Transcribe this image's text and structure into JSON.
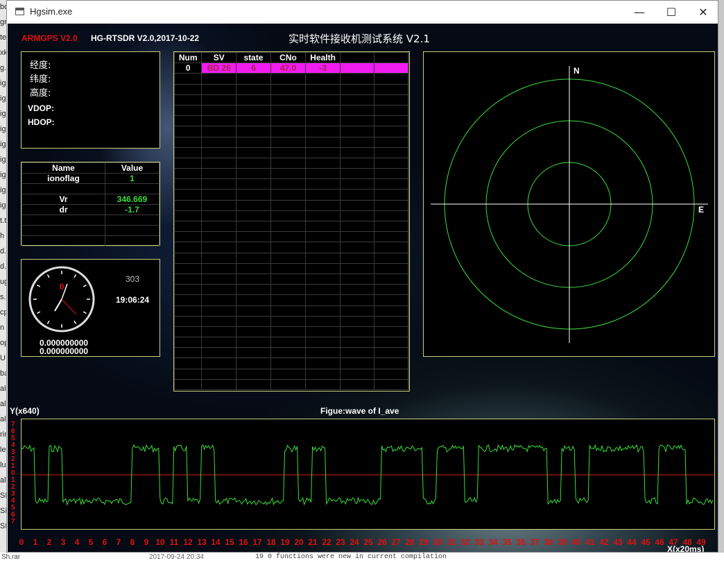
{
  "window": {
    "title": "Hgsim.exe",
    "minimize_glyph": "—",
    "maximize_glyph": "☐",
    "close_glyph": "✕"
  },
  "header": {
    "brand": "ARMGPS V2.0",
    "version": "HG-RTSDR V2.0,2017-10-22",
    "system_title": "实时软件接收机测试系统 V2.1"
  },
  "position": {
    "lon_label": "经度:",
    "lat_label": "纬度:",
    "alt_label": "高度:",
    "vdop_label": "VDOP:",
    "hdop_label": "HDOP:"
  },
  "name_value": {
    "headers": [
      "Name",
      "Value"
    ],
    "rows": [
      {
        "name": "ionoflag",
        "value": "1"
      },
      {
        "name": "",
        "value": ""
      },
      {
        "name": "Vr",
        "value": "346.669"
      },
      {
        "name": "dr",
        "value": "-1.7"
      },
      {
        "name": "",
        "value": ""
      },
      {
        "name": "",
        "value": ""
      },
      {
        "name": "",
        "value": ""
      }
    ]
  },
  "clock": {
    "dial_mark": "0",
    "counter": "303",
    "time": "19:06:24",
    "value_1": "0.000000000",
    "value_2": "0.000000000"
  },
  "sv_table": {
    "headers": [
      "Num",
      "SV",
      "state",
      "CNo",
      "Health",
      "",
      "",
      ""
    ],
    "rows": [
      {
        "num": "0",
        "sv": "BD 26",
        "state": "6",
        "cno": "47.0",
        "health": "-3"
      }
    ],
    "empty_rows": 30
  },
  "skyplot": {
    "north_label": "N",
    "east_label": "E"
  },
  "wave": {
    "title": "Figue:wave of I_ave",
    "ylabel": "Y(x640)",
    "xlabel": "X(x20ms)",
    "y_ticks": [
      "7",
      "6",
      "5",
      "4",
      "3",
      "2",
      "1",
      "0",
      "1",
      "2",
      "3",
      "4",
      "5",
      "6",
      "7"
    ],
    "x_ticks": [
      "0",
      "1",
      "2",
      "3",
      "4",
      "5",
      "6",
      "7",
      "8",
      "9",
      "10",
      "11",
      "12",
      "13",
      "14",
      "15",
      "16",
      "17",
      "18",
      "19",
      "20",
      "21",
      "22",
      "23",
      "24",
      "25",
      "26",
      "27",
      "28",
      "29",
      "30",
      "31",
      "32",
      "33",
      "34",
      "35",
      "36",
      "37",
      "38",
      "39",
      "40",
      "41",
      "42",
      "43",
      "44",
      "45",
      "46",
      "47",
      "48",
      "49"
    ],
    "bits": [
      1,
      0,
      1,
      0,
      0,
      0,
      0,
      0,
      1,
      1,
      0,
      1,
      0,
      1,
      0,
      0,
      0,
      0,
      0,
      1,
      0,
      1,
      0,
      0,
      0,
      0,
      1,
      1,
      1,
      0,
      1,
      1,
      0,
      1,
      1,
      1,
      1,
      1,
      0,
      1,
      0,
      1,
      1,
      1,
      1,
      0,
      1,
      1,
      0,
      0
    ],
    "colors": {
      "signal": "#3adc3a",
      "zero_line": "#d02020",
      "ticks": "#e01010"
    }
  },
  "background": {
    "left_strip_fragments": [
      "bo",
      "gr",
      "te",
      "xk",
      "g.t",
      "ig",
      "ig",
      "ig",
      "ig",
      "ig",
      "ig",
      "ig",
      "ig",
      "ig",
      "t.t",
      "h",
      "d.",
      "d.",
      "ug",
      "s.t",
      "cp",
      "n",
      "op",
      "U",
      "ba",
      "all",
      "all",
      "all",
      "rin",
      "le",
      "lu",
      "all",
      "SI",
      "SI",
      "SI"
    ],
    "bottom_left": "Sh.rar",
    "bottom_date": "2017-09-24 20:34",
    "bottom_console": "19     0 functions were new in current compilation"
  }
}
